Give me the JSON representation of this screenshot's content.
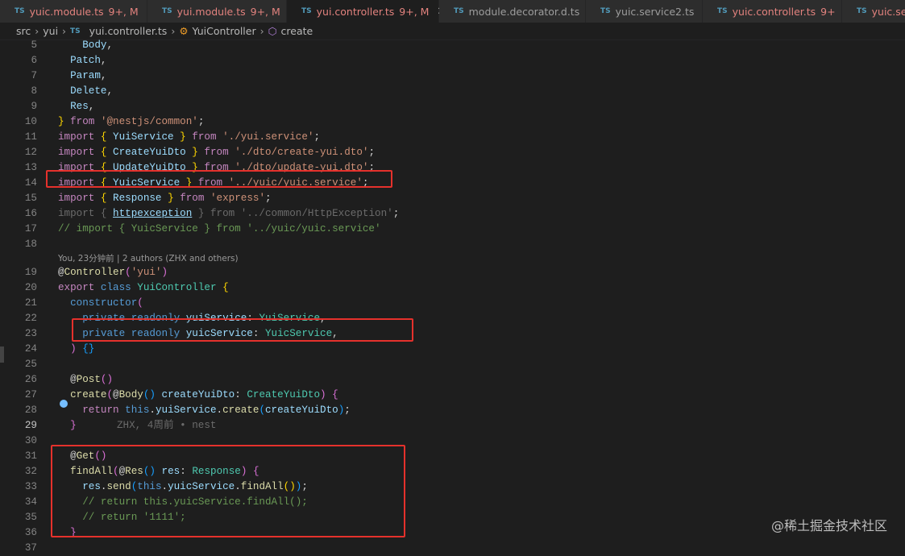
{
  "tabs": [
    {
      "name": "yuic.module.ts",
      "badge": "9+, M",
      "active": false,
      "modified": true
    },
    {
      "name": "yui.module.ts",
      "badge": "9+, M",
      "active": false,
      "modified": true
    },
    {
      "name": "yui.controller.ts",
      "badge": "9+, M",
      "active": true,
      "modified": true
    },
    {
      "name": "module.decorator.d.ts",
      "badge": "",
      "active": false,
      "modified": false
    },
    {
      "name": "yuic.service2.ts",
      "badge": "",
      "active": false,
      "modified": false
    },
    {
      "name": "yuic.controller.ts",
      "badge": "9+",
      "active": false,
      "modified": true
    },
    {
      "name": "yuic.ser",
      "badge": "",
      "active": false,
      "modified": true
    }
  ],
  "tab_file_icon": "TS",
  "breadcrumb": {
    "parts": [
      "src",
      "yui"
    ],
    "file": "yui.controller.ts",
    "class": "YuiController",
    "method": "create"
  },
  "codelens": "You, 23分钟前 | 2 authors (ZHX and others)",
  "blame": "ZHX, 4周前 • nest",
  "watermark": "@稀土掘金技术社区",
  "current_line": 29,
  "lines": [
    {
      "n": 5,
      "t": [
        [
          "    ",
          "p"
        ],
        [
          "Body",
          "id"
        ],
        [
          ",",
          "p"
        ]
      ]
    },
    {
      "n": 6,
      "t": [
        [
          "  Patch",
          "id"
        ],
        [
          ",",
          "p"
        ]
      ]
    },
    {
      "n": 7,
      "t": [
        [
          "  Param",
          "id"
        ],
        [
          ",",
          "p"
        ]
      ]
    },
    {
      "n": 8,
      "t": [
        [
          "  Delete",
          "id"
        ],
        [
          ",",
          "p"
        ]
      ]
    },
    {
      "n": 9,
      "t": [
        [
          "  Res",
          "id"
        ],
        [
          ",",
          "p"
        ]
      ]
    },
    {
      "n": 10,
      "t": [
        [
          "} ",
          "br"
        ],
        [
          "from ",
          "kw"
        ],
        [
          "'@nestjs/common'",
          "str"
        ],
        [
          ";",
          "p"
        ]
      ]
    },
    {
      "n": 11,
      "t": [
        [
          "import ",
          "kw"
        ],
        [
          "{ ",
          "br"
        ],
        [
          "YuiService ",
          "id"
        ],
        [
          "} ",
          "br"
        ],
        [
          "from ",
          "kw"
        ],
        [
          "'./yui.service'",
          "str"
        ],
        [
          ";",
          "p"
        ]
      ]
    },
    {
      "n": 12,
      "t": [
        [
          "import ",
          "kw"
        ],
        [
          "{ ",
          "br"
        ],
        [
          "CreateYuiDto ",
          "id"
        ],
        [
          "} ",
          "br"
        ],
        [
          "from ",
          "kw"
        ],
        [
          "'./dto/create-yui.dto'",
          "str"
        ],
        [
          ";",
          "p"
        ]
      ]
    },
    {
      "n": 13,
      "t": [
        [
          "import ",
          "kw"
        ],
        [
          "{ ",
          "br"
        ],
        [
          "UpdateYuiDto ",
          "id"
        ],
        [
          "} ",
          "br"
        ],
        [
          "from ",
          "kw"
        ],
        [
          "'./dto/update-yui.dto'",
          "str"
        ],
        [
          ";",
          "p"
        ]
      ]
    },
    {
      "n": 14,
      "t": [
        [
          "import ",
          "kw"
        ],
        [
          "{ ",
          "br"
        ],
        [
          "YuicService ",
          "id"
        ],
        [
          "} ",
          "br"
        ],
        [
          "from ",
          "kw"
        ],
        [
          "'../yuic/yuic.service'",
          "str"
        ],
        [
          ";",
          "p"
        ]
      ]
    },
    {
      "n": 15,
      "t": [
        [
          "import ",
          "kw"
        ],
        [
          "{ ",
          "br"
        ],
        [
          "Response ",
          "id"
        ],
        [
          "} ",
          "br"
        ],
        [
          "from ",
          "kw"
        ],
        [
          "'express'",
          "str"
        ],
        [
          ";",
          "p"
        ]
      ]
    },
    {
      "n": 16,
      "t": [
        [
          "import ",
          "ghost"
        ],
        [
          "{ ",
          "ghost"
        ],
        [
          "httpexception",
          "id ul"
        ],
        [
          " } from '../common/HttpException'",
          "ghost"
        ],
        [
          ";",
          "p"
        ]
      ]
    },
    {
      "n": 17,
      "t": [
        [
          "// import { YuicService } from '../yuic/yuic.service'",
          "cm"
        ]
      ]
    },
    {
      "n": 18,
      "t": []
    },
    {
      "n": 19,
      "t": [
        [
          "@",
          "p"
        ],
        [
          "Controller",
          "fn"
        ],
        [
          "(",
          "br2"
        ],
        [
          "'yui'",
          "str"
        ],
        [
          ")",
          "br2"
        ]
      ]
    },
    {
      "n": 20,
      "t": [
        [
          "export ",
          "kw"
        ],
        [
          "class ",
          "st"
        ],
        [
          "YuiController ",
          "ty"
        ],
        [
          "{",
          "br"
        ]
      ]
    },
    {
      "n": 21,
      "t": [
        [
          "  constructor",
          "st"
        ],
        [
          "(",
          "br2"
        ]
      ]
    },
    {
      "n": 22,
      "t": [
        [
          "    private ",
          "st"
        ],
        [
          "readonly ",
          "st"
        ],
        [
          "yuiService",
          "id"
        ],
        [
          ": ",
          "p"
        ],
        [
          "YuiService",
          "ty"
        ],
        [
          ",",
          "p"
        ]
      ]
    },
    {
      "n": 23,
      "t": [
        [
          "    private ",
          "st"
        ],
        [
          "readonly ",
          "st"
        ],
        [
          "yuicService",
          "id"
        ],
        [
          ": ",
          "p"
        ],
        [
          "YuicService",
          "ty"
        ],
        [
          ",",
          "p"
        ]
      ]
    },
    {
      "n": 24,
      "t": [
        [
          "  ) ",
          "br2"
        ],
        [
          "{}",
          "br3"
        ]
      ]
    },
    {
      "n": 25,
      "t": []
    },
    {
      "n": 26,
      "t": [
        [
          "  @",
          "p"
        ],
        [
          "Post",
          "fn"
        ],
        [
          "()",
          "br2"
        ]
      ]
    },
    {
      "n": 27,
      "t": [
        [
          "  create",
          "fn"
        ],
        [
          "(",
          "br2"
        ],
        [
          "@",
          "p"
        ],
        [
          "Body",
          "fn"
        ],
        [
          "() ",
          "br3"
        ],
        [
          "createYuiDto",
          "id"
        ],
        [
          ": ",
          "p"
        ],
        [
          "CreateYuiDto",
          "ty"
        ],
        [
          ") ",
          "br2"
        ],
        [
          "{",
          "br2"
        ]
      ]
    },
    {
      "n": 28,
      "t": [
        [
          "    return ",
          "kw"
        ],
        [
          "this",
          "st"
        ],
        [
          ".",
          "p"
        ],
        [
          "yuiService",
          "id"
        ],
        [
          ".",
          "p"
        ],
        [
          "create",
          "fn"
        ],
        [
          "(",
          "br3"
        ],
        [
          "createYuiDto",
          "id"
        ],
        [
          ")",
          "br3"
        ],
        [
          ";",
          "p"
        ]
      ]
    },
    {
      "n": 29,
      "t": [
        [
          "  }",
          "br2"
        ]
      ]
    },
    {
      "n": 30,
      "t": []
    },
    {
      "n": 31,
      "t": [
        [
          "  @",
          "p"
        ],
        [
          "Get",
          "fn"
        ],
        [
          "()",
          "br2"
        ]
      ]
    },
    {
      "n": 32,
      "t": [
        [
          "  findAll",
          "fn"
        ],
        [
          "(",
          "br2"
        ],
        [
          "@",
          "p"
        ],
        [
          "Res",
          "fn"
        ],
        [
          "() ",
          "br3"
        ],
        [
          "res",
          "id"
        ],
        [
          ": ",
          "p"
        ],
        [
          "Response",
          "ty"
        ],
        [
          ") ",
          "br2"
        ],
        [
          "{",
          "br2"
        ]
      ]
    },
    {
      "n": 33,
      "t": [
        [
          "    res",
          "id"
        ],
        [
          ".",
          "p"
        ],
        [
          "send",
          "fn"
        ],
        [
          "(",
          "br3"
        ],
        [
          "this",
          "st"
        ],
        [
          ".",
          "p"
        ],
        [
          "yuicService",
          "id"
        ],
        [
          ".",
          "p"
        ],
        [
          "findAll",
          "fn"
        ],
        [
          "()",
          "br"
        ],
        [
          ")",
          "br3"
        ],
        [
          ";",
          "p"
        ]
      ]
    },
    {
      "n": 34,
      "t": [
        [
          "    // return this.yuicService.findAll();",
          "cm"
        ]
      ]
    },
    {
      "n": 35,
      "t": [
        [
          "    // return '1111';",
          "cm"
        ]
      ]
    },
    {
      "n": 36,
      "t": [
        [
          "  }",
          "br2"
        ]
      ]
    },
    {
      "n": 37,
      "t": []
    }
  ],
  "highlight_color": "#e5312c"
}
